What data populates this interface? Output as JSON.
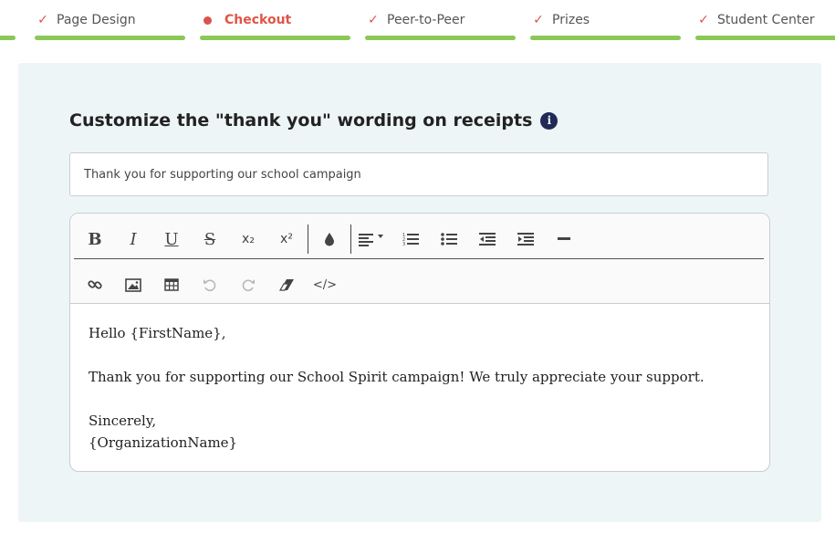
{
  "steps": [
    {
      "label": "Page Design",
      "status": "done"
    },
    {
      "label": "Checkout",
      "status": "active"
    },
    {
      "label": "Peer-to-Peer",
      "status": "done"
    },
    {
      "label": "Prizes",
      "status": "done"
    },
    {
      "label": "Student Center",
      "status": "done"
    }
  ],
  "colors": {
    "accent": "#e05545",
    "progress": "#8ac857",
    "panel": "#eef5f6",
    "info_icon": "#1f2a56"
  },
  "section": {
    "title": "Customize the \"thank you\" wording on receipts",
    "info_icon": "info-icon"
  },
  "subject_input": {
    "value": "Thank you for supporting our school campaign"
  },
  "toolbar": {
    "row1": [
      "bold-icon",
      "italic-icon",
      "underline-icon",
      "strikethrough-icon",
      "subscript-icon",
      "superscript-icon",
      "text-color-icon",
      "align-dropdown-icon",
      "ordered-list-icon",
      "unordered-list-icon",
      "outdent-icon",
      "indent-icon",
      "horizontal-rule-icon"
    ],
    "row2": [
      "link-icon",
      "image-icon",
      "table-icon",
      "undo-icon",
      "redo-icon",
      "clear-format-icon",
      "code-view-icon"
    ],
    "bold": "B",
    "italic": "I",
    "underline": "U",
    "strike": "S",
    "sub": "x₂",
    "sup": "x²",
    "code": "</>"
  },
  "editor": {
    "greeting": "Hello {FirstName},",
    "body": "Thank you for supporting our School Spirit campaign! We truly appreciate your support.",
    "closing": "Sincerely,",
    "signature": "{OrganizationName}"
  }
}
